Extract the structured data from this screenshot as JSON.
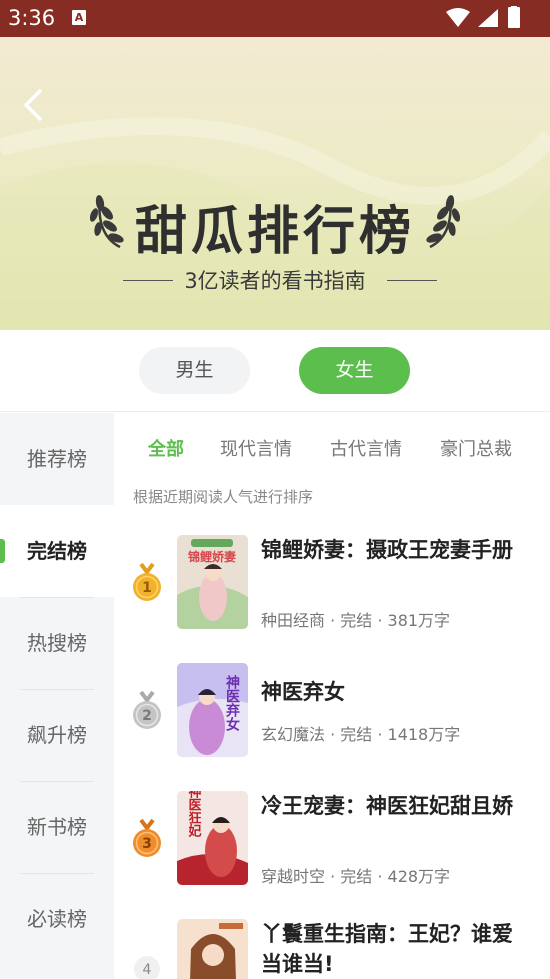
{
  "status_bar": {
    "time": "3:36",
    "notification_icon": "a-notification-icon",
    "icons": [
      "wifi-icon",
      "signal-icon",
      "battery-icon"
    ]
  },
  "hero": {
    "title": "甜瓜排行榜",
    "subtitle": "3亿读者的看书指南"
  },
  "gender_tabs": [
    {
      "label": "男生",
      "active": false
    },
    {
      "label": "女生",
      "active": true
    }
  ],
  "sidebar": {
    "items": [
      {
        "label": "推荐榜",
        "active": false
      },
      {
        "label": "完结榜",
        "active": true
      },
      {
        "label": "热搜榜",
        "active": false
      },
      {
        "label": "飙升榜",
        "active": false
      },
      {
        "label": "新书榜",
        "active": false
      },
      {
        "label": "必读榜",
        "active": false
      }
    ]
  },
  "category_tabs": [
    {
      "label": "全部",
      "active": true
    },
    {
      "label": "现代言情",
      "active": false
    },
    {
      "label": "古代言情",
      "active": false
    },
    {
      "label": "豪门总裁",
      "active": false
    }
  ],
  "hint": "根据近期阅读人气进行排序",
  "books": [
    {
      "rank": "1",
      "title": "锦鲤娇妻：摄政王宠妻手册",
      "meta": "种田经商 · 完结 · 381万字",
      "cover_text": "锦鲤娇妻"
    },
    {
      "rank": "2",
      "title": "神医弃女",
      "meta": "玄幻魔法 · 完结 · 1418万字",
      "cover_text": "神医弃女"
    },
    {
      "rank": "3",
      "title": "冷王宠妻：神医狂妃甜且娇",
      "meta": "穿越时空 · 完结 · 428万字",
      "cover_text": "神医狂妃"
    },
    {
      "rank": "4",
      "title": "丫鬟重生指南：王妃？谁爱当谁当!",
      "meta": "",
      "cover_text": ""
    }
  ],
  "colors": {
    "status_bar": "#862c22",
    "accent_green": "#5cbe4c",
    "gold": "#f2b12a",
    "silver": "#c4c4c4",
    "bronze": "#ef8d2c"
  }
}
